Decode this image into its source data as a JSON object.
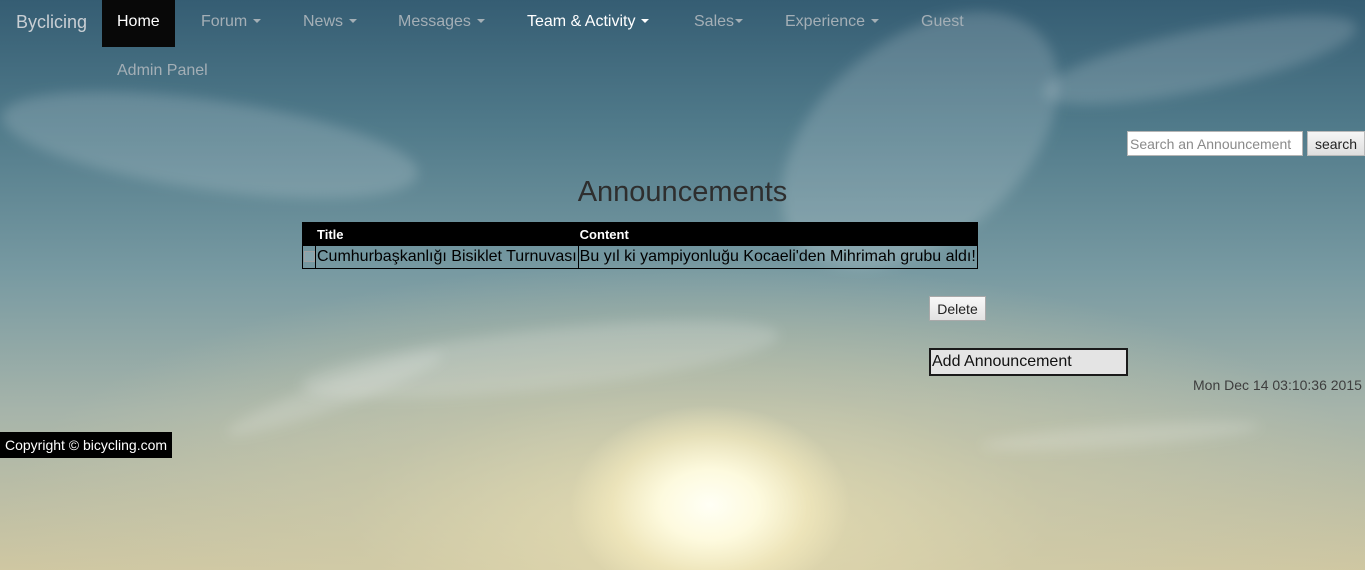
{
  "navbar": {
    "brand": "Byclicing",
    "items": [
      {
        "label": "Home"
      },
      {
        "label": "Forum"
      },
      {
        "label": "News"
      },
      {
        "label": "Messages"
      },
      {
        "label": "Team & Activity"
      },
      {
        "label": "Sales"
      },
      {
        "label": "Experience"
      },
      {
        "label": "Guest"
      }
    ],
    "admin_panel": "Admin Panel"
  },
  "search": {
    "placeholder": "Search an Announcement",
    "button_label": "search"
  },
  "page_title": "Announcements",
  "table": {
    "headers": {
      "title": "Title",
      "content": "Content"
    },
    "rows": [
      {
        "title": "Cumhurbaşkanlığı Bisiklet Turnuvası",
        "content": "Bu yıl ki yampiyonluğu Kocaeli'den Mihrimah grubu aldı!",
        "checked": false
      }
    ]
  },
  "actions": {
    "delete_label": "Delete",
    "add_label": "Add Announcement"
  },
  "timestamp": "Mon Dec 14 03:10:36 2015",
  "footer": {
    "copyright": "Copyright © bicycling.com"
  },
  "colors": {
    "navbar_active_bg": "#080808",
    "nav_text": "#a4afb6",
    "table_header_bg": "#000000"
  }
}
